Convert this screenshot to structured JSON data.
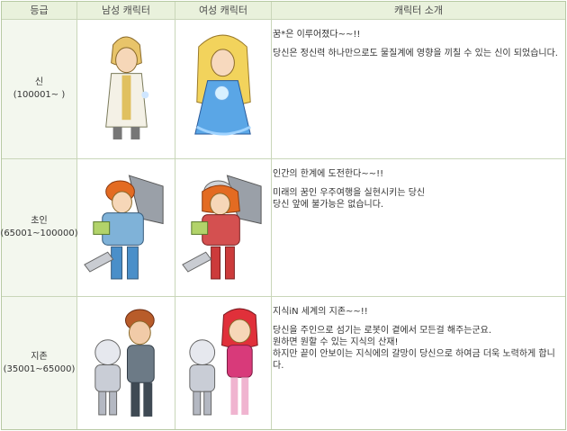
{
  "headers": [
    "등급",
    "남성 캐릭터",
    "여성 캐릭터",
    "캐릭터 소개"
  ],
  "rows": [
    {
      "grade": "신",
      "range": "(100001~ )",
      "male_char": "god-male-icon",
      "female_char": "god-female-icon",
      "intro_title": "꿈*은 이루어졌다~~!!",
      "intro_lines": [
        "당신은 정신력 하나만으로도 물질계에 영향을 끼칠 수 있는 신이 되었습니다."
      ]
    },
    {
      "grade": "초인",
      "range": "(65001~100000)",
      "male_char": "superman-male-icon",
      "female_char": "superman-female-icon",
      "intro_title": "인간의 한계에 도전한다~~!!",
      "intro_lines": [
        "미래의 꿈인 우주여행을 실현시키는 당신",
        "당신 앞에 불가능은 없습니다."
      ]
    },
    {
      "grade": "지존",
      "range": "(35001~65000)",
      "male_char": "supreme-male-icon",
      "female_char": "supreme-female-icon",
      "intro_title": "지식iN 세계의 지존~~!!",
      "intro_lines": [
        "당신을 주인으로 섬기는 로봇이 곁에서 모든걸 해주는군요.",
        "원하면 원할 수 있는 지식의 산재!",
        "하지만 끝이 안보이는 지식에의 갈망이 당신으로 하여금 더욱 노력하게 합니다."
      ]
    }
  ]
}
